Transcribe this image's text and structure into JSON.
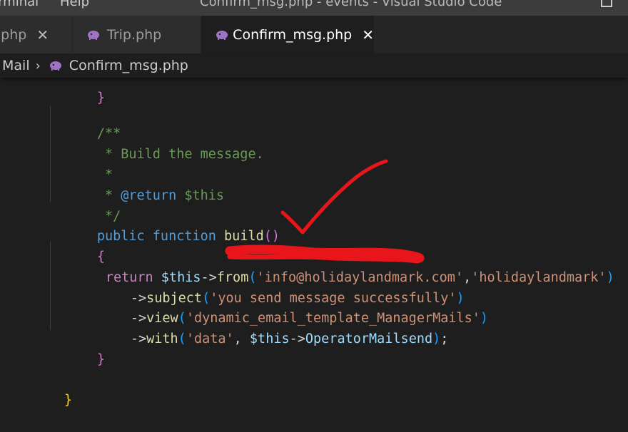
{
  "window": {
    "menu_terminal": "erminal",
    "menu_help": "Help",
    "title": "Confirm_msg.php - events - Visual Studio Code"
  },
  "tabs": [
    {
      "label": "te.php",
      "icon": "php-elephant-icon",
      "active": false
    },
    {
      "label": "Trip.php",
      "icon": "php-elephant-icon",
      "active": false
    },
    {
      "label": "Confirm_msg.php",
      "icon": "php-elephant-icon",
      "active": true
    }
  ],
  "close_glyph": "✕",
  "breadcrumb": {
    "items": [
      "Mail",
      "Confirm_msg.php"
    ],
    "separator": "›"
  },
  "code": {
    "line_0": "}",
    "line_2a": "/**",
    "line_3": " * Build the message.",
    "line_4": " *",
    "line_5a": " * ",
    "line_5b": "@return",
    "line_5c": " $this",
    "line_6": " */",
    "line_7_kw1": "public",
    "line_7_kw2": "function",
    "line_7_fn": "build",
    "line_7_open": "(",
    "line_7_close": ")",
    "line_8": "{",
    "line_9_return": "return",
    "line_9_this": "$this",
    "line_9_arrow": "->",
    "line_9_fn": "from",
    "line_9_open": "(",
    "line_9_str1": "'info@holidaylandmark.com'",
    "line_9_comma": ",",
    "line_9_str2": "'holidaylandmark'",
    "line_9_close": ")",
    "line_10_arrow": "->",
    "line_10_fn": "subject",
    "line_10_open": "(",
    "line_10_str": "'you send message successfully'",
    "line_10_close": ")",
    "line_11_arrow": "->",
    "line_11_fn": "view",
    "line_11_open": "(",
    "line_11_str": "'dynamic_email_template_ManagerMails'",
    "line_11_close": ")",
    "line_12_arrow": "->",
    "line_12_fn": "with",
    "line_12_open": "(",
    "line_12_str": "'data'",
    "line_12_comma": ", ",
    "line_12_this": "$this",
    "line_12_arrow2": "->",
    "line_12_prop": "OperatorMailsend",
    "line_12_close": ")",
    "line_12_semi": ";",
    "line_13": "}",
    "line_15": "}"
  },
  "colors": {
    "editor_bg": "#1e1e1e",
    "comment": "#6a9955",
    "keyword": "#569cd6",
    "string": "#ce9178",
    "function": "#dcdcaa",
    "annotation_red": "#e8161b"
  }
}
